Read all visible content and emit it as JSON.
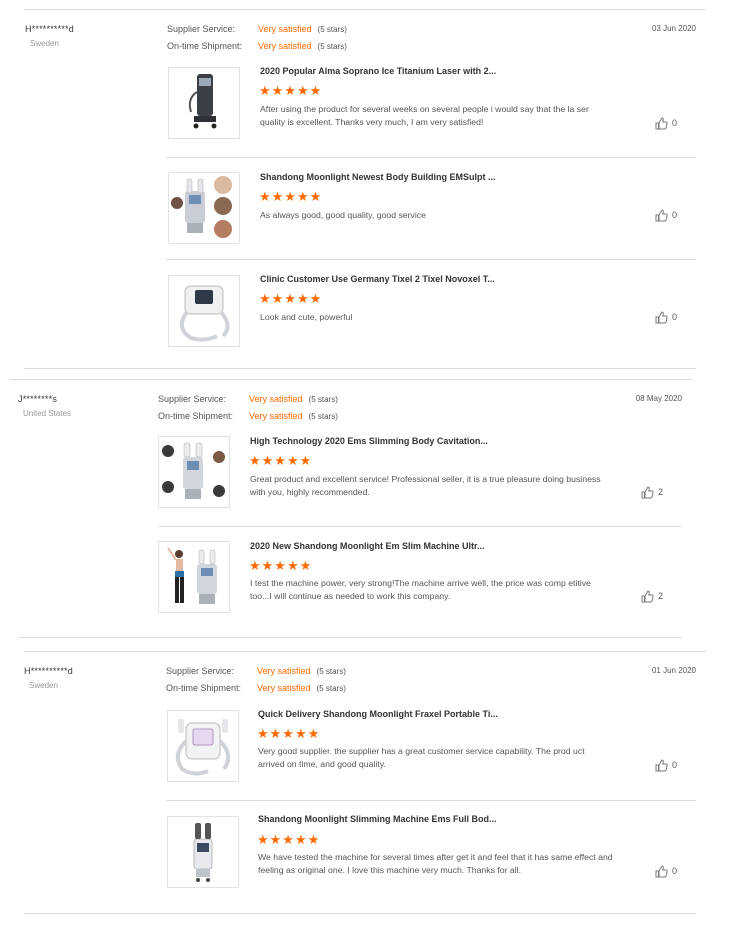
{
  "labels": {
    "supplier_service": "Supplier Service:",
    "ontime_shipment": "On-time Shipment:"
  },
  "reviews": [
    {
      "name": "H**********d",
      "country": "Sweden",
      "date": "03 Jun 2020",
      "supplier_service": "Very satisfied",
      "supplier_stars": "(5 stars)",
      "shipment": "Very satisfied",
      "shipment_stars": "(5 stars)",
      "products": [
        {
          "title": "2020 Popular Alma Soprano Ice Titanium Laser with 2...",
          "stars": "★★★★★",
          "comment": "After using the product for several weeks on several people i would say that the la ser quality is excellent. Thanks very much, I am very satisfied!",
          "likes": "0",
          "image": "tower-laser"
        },
        {
          "title": "Shandong Moonlight Newest Body Building EMSulpt ...",
          "stars": "★★★★★",
          "comment": "As always good, good quality, good service",
          "likes": "0",
          "image": "ems-machine-collage"
        },
        {
          "title": "Clinic Customer Use Germany Tixel 2 Tixel Novoxel T...",
          "stars": "★★★★★",
          "comment": "Look and cute, powerful",
          "likes": "0",
          "image": "tixel-device"
        }
      ]
    },
    {
      "name": "J********s",
      "country": "United States",
      "date": "08 May 2020",
      "supplier_service": "Very satisfied",
      "supplier_stars": "(5 stars)",
      "shipment": "Very satisfied",
      "shipment_stars": "(5 stars)",
      "products": [
        {
          "title": "High Technology 2020 Ems Slimming Body Cavitation...",
          "stars": "★★★★★",
          "comment": "Great product and excellent service! Professional seller, it is a true pleasure doing business with you, highly recommended.",
          "likes": "2",
          "image": "ems-machine-collage"
        },
        {
          "title": "2020 New Shandong Moonlight Em Slim Machine Ultr...",
          "stars": "★★★★★",
          "comment": "I test the machine power, very strong!The machine arrive well, the price was comp etitive too...I will continue as needed to work this company.",
          "likes": "2",
          "image": "model-with-machine"
        }
      ]
    },
    {
      "name": "H**********d",
      "country": "Sweden",
      "date": "01 Jun 2020",
      "supplier_service": "Very satisfied",
      "supplier_stars": "(5 stars)",
      "shipment": "Very satisfied",
      "shipment_stars": "(5 stars)",
      "products": [
        {
          "title": "Quick Delivery Shandong Moonlight Fraxel Portable Ti...",
          "stars": "★★★★★",
          "comment": "Very good supplier. the supplier has a great customer service capability. The prod uct arrived on time, and good quality.",
          "likes": "0",
          "image": "portable-device"
        },
        {
          "title": "Shandong Moonlight Slimming Machine Ems Full Bod...",
          "stars": "★★★★★",
          "comment": "We have tested the machine for several times after get it and feel that it has same effect and feeling as original one. I love this machine very much. Thanks for all.",
          "likes": "0",
          "image": "slim-tower"
        }
      ]
    }
  ]
}
